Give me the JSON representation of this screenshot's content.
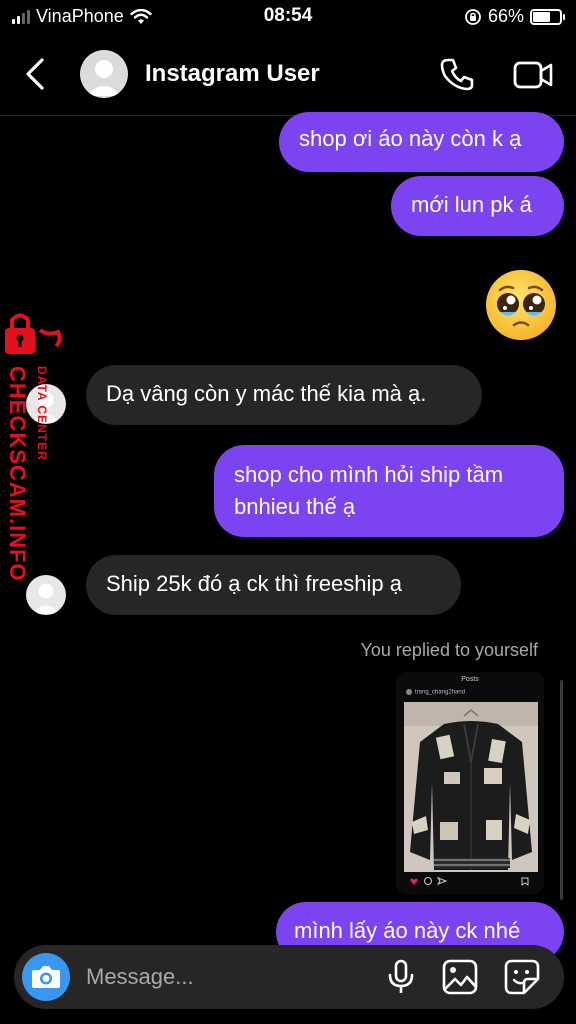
{
  "status_bar": {
    "carrier": "VinaPhone",
    "time": "08:54",
    "battery": "66%",
    "battery_level": 0.66
  },
  "header": {
    "title": "Instagram User"
  },
  "messages": [
    {
      "side": "sent",
      "text": "shop ơi áo này còn k ạ"
    },
    {
      "side": "sent",
      "text": "mới lun pk á"
    },
    {
      "side": "sent",
      "emoji": "pleading-face"
    },
    {
      "side": "received",
      "text": "Dạ vâng còn y mác thế kia mà ạ."
    },
    {
      "side": "sent",
      "text": "shop cho mình hỏi ship tầm bnhieu thế ạ"
    },
    {
      "side": "received",
      "text": "Ship 25k đó ạ ck thì freeship ạ"
    },
    {
      "side": "sent",
      "note": "You replied to yourself"
    },
    {
      "side": "sent",
      "shared_post": {
        "header": "Posts",
        "username": "trang_chang2hand"
      }
    },
    {
      "side": "sent",
      "text": "mình lấy áo này ck nhé"
    }
  ],
  "watermark": {
    "main": "CHECKSCAM.INFO",
    "sub": "DATA CENTER"
  },
  "composer": {
    "placeholder": "Message..."
  },
  "colors": {
    "sent_bubble": "#7b44f0",
    "received_bubble": "#262626",
    "camera_button": "#3897f0",
    "watermark": "#e3101d"
  }
}
